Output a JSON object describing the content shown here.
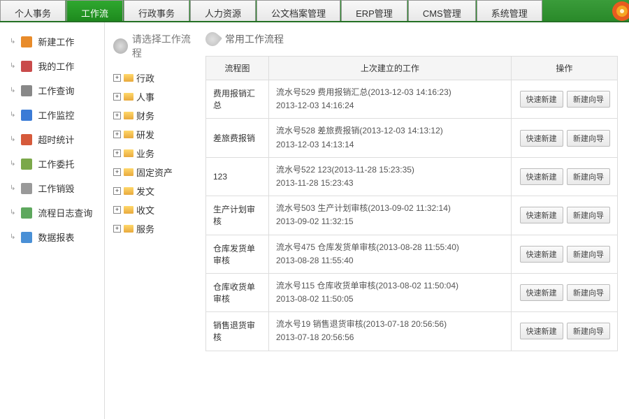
{
  "nav": {
    "tabs": [
      "个人事务",
      "工作流",
      "行政事务",
      "人力资源",
      "公文档案管理",
      "ERP管理",
      "CMS管理",
      "系统管理"
    ],
    "active": 1
  },
  "sidebar": {
    "items": [
      {
        "label": "新建工作",
        "color": "#e88b2a"
      },
      {
        "label": "我的工作",
        "color": "#c94b4b"
      },
      {
        "label": "工作查询",
        "color": "#888"
      },
      {
        "label": "工作监控",
        "color": "#3b7bd6"
      },
      {
        "label": "超时统计",
        "color": "#d65a3b"
      },
      {
        "label": "工作委托",
        "color": "#7ba84a"
      },
      {
        "label": "工作销毁",
        "color": "#999"
      },
      {
        "label": "流程日志查询",
        "color": "#5ea85e"
      },
      {
        "label": "数据报表",
        "color": "#4a90d6"
      }
    ]
  },
  "tree": {
    "title": "请选择工作流程",
    "nodes": [
      "行政",
      "人事",
      "财务",
      "研发",
      "业务",
      "固定资产",
      "发文",
      "收文",
      "服务"
    ]
  },
  "panel": {
    "title": "常用工作流程",
    "columns": {
      "flow": "流程图",
      "last": "上次建立的工作",
      "ops": "操作"
    },
    "btn_quick": "快速新建",
    "btn_wizard": "新建向导",
    "rows": [
      {
        "name": "费用报销汇总",
        "line1": "流水号529 费用报销汇总(2013-12-03 14:16:23)",
        "line2": "2013-12-03 14:16:24"
      },
      {
        "name": "差旅费报销",
        "line1": "流水号528 差旅费报销(2013-12-03 14:13:12)",
        "line2": "2013-12-03 14:13:14"
      },
      {
        "name": "123",
        "line1": "流水号522 123(2013-11-28 15:23:35)",
        "line2": "2013-11-28 15:23:43"
      },
      {
        "name": "生产计划审核",
        "line1": "流水号503 生产计划审核(2013-09-02 11:32:14)",
        "line2": "2013-09-02 11:32:15"
      },
      {
        "name": "仓库发货单审核",
        "line1": "流水号475 仓库发货单审核(2013-08-28 11:55:40)",
        "line2": "2013-08-28 11:55:40"
      },
      {
        "name": "仓库收货单审核",
        "line1": "流水号115 仓库收货单审核(2013-08-02 11:50:04)",
        "line2": "2013-08-02 11:50:05"
      },
      {
        "name": "销售退货审核",
        "line1": "流水号19 销售退货审核(2013-07-18 20:56:56)",
        "line2": "2013-07-18 20:56:56"
      }
    ]
  }
}
